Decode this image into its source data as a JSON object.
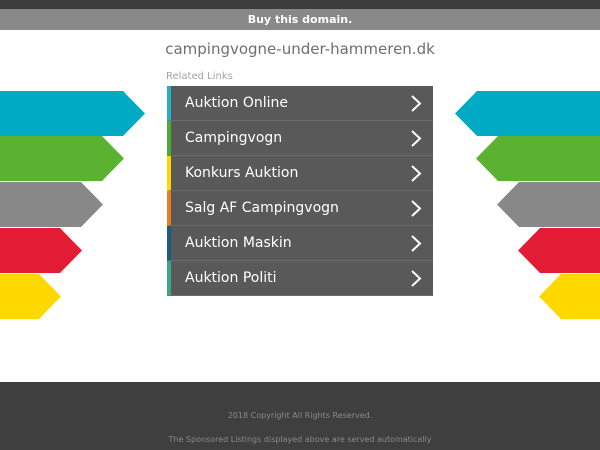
{
  "buy_bar": {
    "label": "Buy this domain."
  },
  "domain_name": "campingvogne-under-hammeren.dk",
  "related_links_heading": "Related Links",
  "links": [
    {
      "label": "Auktion Online",
      "accent": "#23b0c8"
    },
    {
      "label": "Campingvogn",
      "accent": "#4dab35"
    },
    {
      "label": "Konkurs Auktion",
      "accent": "#ffd800"
    },
    {
      "label": "Salg AF Campingvogn",
      "accent": "#e67e22"
    },
    {
      "label": "Auktion Maskin",
      "accent": "#1c5d79"
    },
    {
      "label": "Auktion Politi",
      "accent": "#3aa68a"
    }
  ],
  "decor_colors": [
    "#00a9c4",
    "#5bb130",
    "#888888",
    "#e21c34",
    "#ffd800"
  ],
  "footer": {
    "copyright": "2018 Copyright All Rights Reserved.",
    "disclaimer": "The Sponsored Listings displayed above are served automatically"
  }
}
